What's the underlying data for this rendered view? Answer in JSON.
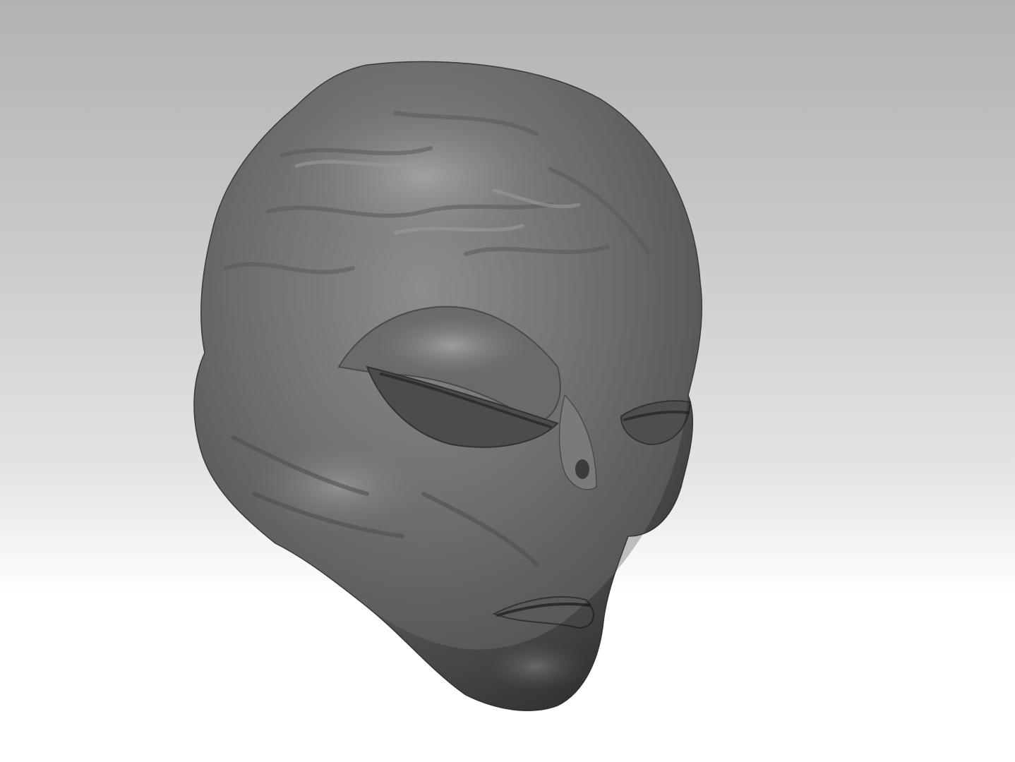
{
  "scene": {
    "subject": "alien-head-sculpt",
    "material_color": "#6e6e6e",
    "background_top": "#b2b2b2",
    "background_bottom": "#ffffff"
  }
}
